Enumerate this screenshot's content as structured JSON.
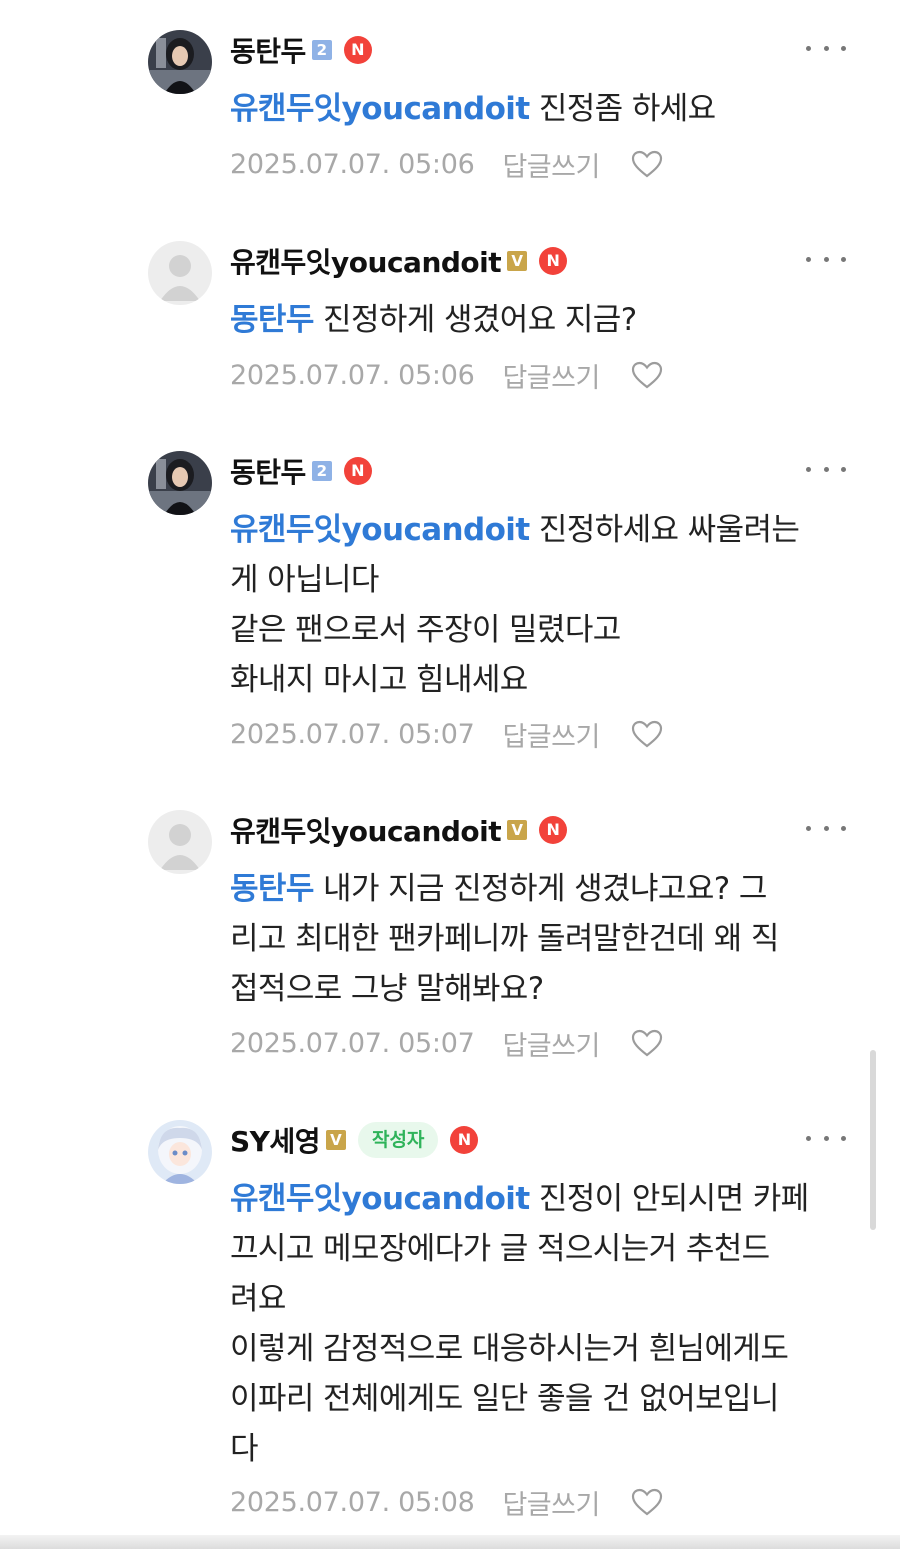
{
  "comments": [
    {
      "author": "동탄두",
      "level_badge": "2",
      "n_badge": "N",
      "avatar": "photo-avatar",
      "more_icon": "more-dots-icon",
      "lines": [
        {
          "mention": "유캔두잇youcandoit",
          "text": " 진정좀 하세요"
        }
      ],
      "timestamp": "2025.07.07. 05:06",
      "reply_label": "답글쓰기",
      "like_icon": "heart-outline-icon"
    },
    {
      "author": "유캔두잇youcandoit",
      "level_badge": "V",
      "n_badge": "N",
      "avatar": "default-avatar",
      "more_icon": "more-dots-icon",
      "lines": [
        {
          "mention": "동탄두",
          "text": " 진정하게 생겼어요 지금?"
        }
      ],
      "timestamp": "2025.07.07. 05:06",
      "reply_label": "답글쓰기",
      "like_icon": "heart-outline-icon"
    },
    {
      "author": "동탄두",
      "level_badge": "2",
      "n_badge": "N",
      "avatar": "photo-avatar",
      "more_icon": "more-dots-icon",
      "lines": [
        {
          "mention": "유캔두잇youcandoit",
          "text": " 진정하세요 싸울려는"
        },
        {
          "mention": "",
          "text": "게 아닙니다"
        },
        {
          "mention": "",
          "text": "같은 팬으로서 주장이 밀렸다고"
        },
        {
          "mention": "",
          "text": "화내지 마시고 힘내세요"
        }
      ],
      "timestamp": "2025.07.07. 05:07",
      "reply_label": "답글쓰기",
      "like_icon": "heart-outline-icon"
    },
    {
      "author": "유캔두잇youcandoit",
      "level_badge": "V",
      "n_badge": "N",
      "avatar": "default-avatar",
      "more_icon": "more-dots-icon",
      "lines": [
        {
          "mention": "동탄두",
          "text": " 내가 지금 진정하게 생겼냐고요? 그"
        },
        {
          "mention": "",
          "text": "리고 최대한 팬카페니까 돌려말한건데 왜 직"
        },
        {
          "mention": "",
          "text": "접적으로 그냥 말해봐요?"
        }
      ],
      "timestamp": "2025.07.07. 05:07",
      "reply_label": "답글쓰기",
      "like_icon": "heart-outline-icon"
    },
    {
      "author": "SY세영",
      "level_badge": "V",
      "writer_tag": "작성자",
      "n_badge": "N",
      "avatar": "anime-avatar",
      "more_icon": "more-dots-icon",
      "lines": [
        {
          "mention": "유캔두잇youcandoit",
          "text": " 진정이 안되시면 카페"
        },
        {
          "mention": "",
          "text": "끄시고 메모장에다가 글 적으시는거 추천드"
        },
        {
          "mention": "",
          "text": "려요"
        },
        {
          "mention": "",
          "text": "이렇게 감정적으로 대응하시는거 흰님에게도"
        },
        {
          "mention": "",
          "text": "이파리 전체에게도 일단 좋을 건 없어보입니"
        },
        {
          "mention": "",
          "text": "다"
        }
      ],
      "timestamp": "2025.07.07. 05:08",
      "reply_label": "답글쓰기",
      "like_icon": "heart-outline-icon"
    }
  ],
  "colors": {
    "mention": "#2f7ad6",
    "meta": "#a8a8a8",
    "n_badge": "#f2423a",
    "writer_tag_bg": "#e8f8ec",
    "writer_tag_text": "#2fb35a"
  }
}
